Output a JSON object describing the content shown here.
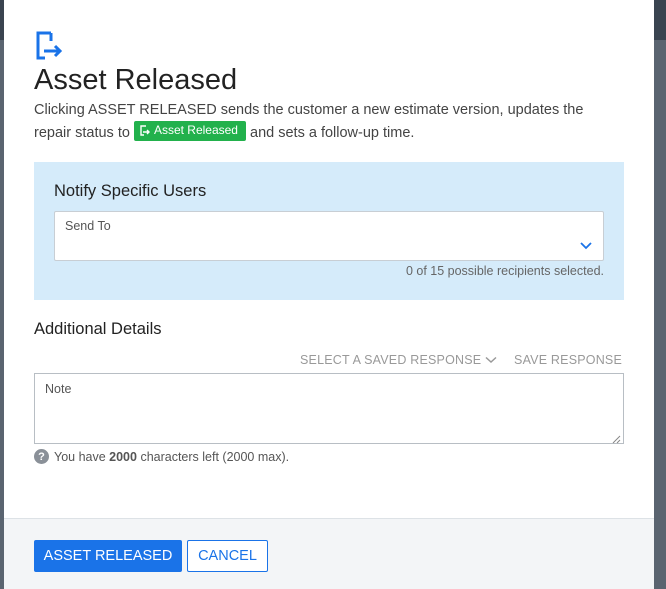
{
  "colors": {
    "accent": "#1a73e8",
    "status_green": "#22b14c",
    "panel_bg": "#d5ebfa"
  },
  "modal": {
    "header_icon": "asset-released-icon",
    "title": "Asset Released",
    "description_before": "Clicking ASSET RELEASED sends the customer a new estimate version, updates the repair status to ",
    "status_pill": "Asset Released",
    "description_after": " and sets a follow-up time."
  },
  "notify": {
    "title": "Notify Specific Users",
    "send_to_label": "Send To",
    "recipients_text": "0 of 15 possible recipients selected."
  },
  "additional": {
    "title": "Additional Details",
    "saved_response_label": "SELECT A SAVED RESPONSE",
    "save_response_label": "SAVE RESPONSE",
    "note_label": "Note",
    "chars_prefix": "You have ",
    "chars_left": "2000",
    "chars_suffix": " characters left (2000 max)."
  },
  "footer": {
    "confirm_label": "ASSET RELEASED",
    "cancel_label": "CANCEL"
  }
}
